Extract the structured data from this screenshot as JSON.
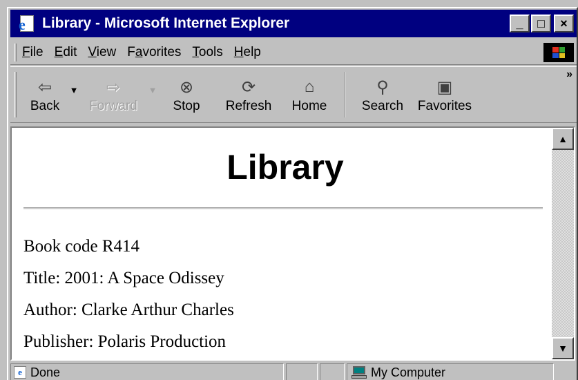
{
  "window": {
    "title": "Library - Microsoft Internet Explorer",
    "controls": {
      "minimize": "_",
      "maximize": "□",
      "close": "×"
    }
  },
  "menu": {
    "items": [
      {
        "accel": "F",
        "rest": "ile"
      },
      {
        "accel": "E",
        "rest": "dit"
      },
      {
        "accel": "V",
        "rest": "iew"
      },
      {
        "pre": "F",
        "accel": "a",
        "rest": "vorites"
      },
      {
        "accel": "T",
        "rest": "ools"
      },
      {
        "accel": "H",
        "rest": "elp"
      }
    ]
  },
  "toolbar": {
    "back": "Back",
    "forward": "Forward",
    "stop": "Stop",
    "refresh": "Refresh",
    "home": "Home",
    "search": "Search",
    "favorites": "Favorites",
    "more": "»"
  },
  "icons": {
    "back": "back-arrow-icon",
    "forward": "forward-arrow-icon",
    "stop": "stop-icon",
    "refresh": "refresh-icon",
    "home": "home-icon",
    "search": "search-icon",
    "favorites": "favorites-folder-icon"
  },
  "page": {
    "heading": "Library",
    "book_code": "Book code R414",
    "title": "Title: 2001: A Space Odissey",
    "author": "Author: Clarke Arthur Charles",
    "publisher": "Publisher: Polaris Production"
  },
  "status": {
    "text": "Done",
    "zone": "My Computer"
  },
  "colors": {
    "titlebar": "#000080",
    "chrome": "#c0c0c0",
    "page_background": "#ffffff"
  }
}
